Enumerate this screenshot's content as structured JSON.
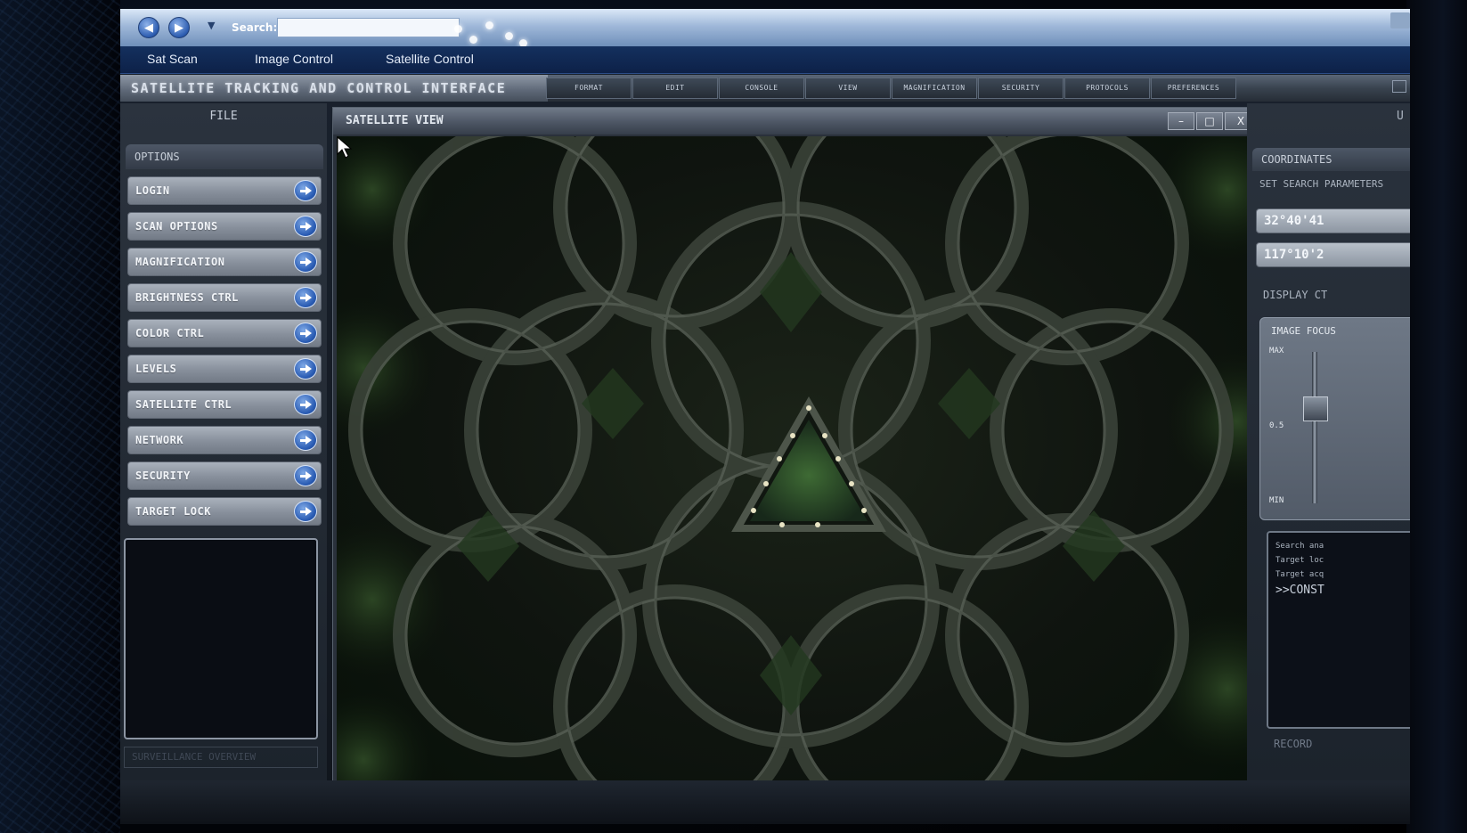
{
  "browser": {
    "search_label": "Search:",
    "search_value": ""
  },
  "top_menu": [
    "Sat Scan",
    "Image Control",
    "Satellite Control"
  ],
  "app": {
    "title": "SATELLITE TRACKING AND CONTROL INTERFACE",
    "menu": [
      "FORMAT",
      "EDIT",
      "CONSOLE",
      "VIEW",
      "MAGNIFICATION",
      "SECURITY",
      "PROTOCOLS",
      "PREFERENCES"
    ]
  },
  "left_panel": {
    "file_label": "FILE",
    "options_header": "OPTIONS",
    "buttons": [
      "LOGIN",
      "SCAN OPTIONS",
      "MAGNIFICATION",
      "BRIGHTNESS CTRL",
      "COLOR CTRL",
      "LEVELS",
      "SATELLITE CTRL",
      "NETWORK",
      "SECURITY",
      "TARGET LOCK"
    ],
    "overview_label": "SURVEILLANCE OVERVIEW"
  },
  "satellite_window": {
    "title": "SATELLITE VIEW",
    "controls": {
      "minimize": "–",
      "maximize": "□",
      "close": "X"
    }
  },
  "right_panel": {
    "top_label": "U",
    "coord_header": "COORDINATES",
    "search_params": "SET SEARCH PARAMETERS",
    "latitude": "32°40'41",
    "longitude": "117°10'2",
    "display_label": "DISPLAY CT",
    "focus_label": "IMAGE FOCUS",
    "slider_max": "MAX",
    "slider_mid": "0.5",
    "slider_min": "MIN",
    "focus_level": 0.65,
    "log_lines": [
      "Search ana",
      "Target loc",
      "Target acq"
    ],
    "log_prompt": ">>CONST",
    "record_label": "RECORD"
  },
  "colors": {
    "accent_blue": "#2a5cb4",
    "menubar": "#14305e",
    "button_grey": "#9aa2ad",
    "imagery_green": "#3a5a2e"
  }
}
